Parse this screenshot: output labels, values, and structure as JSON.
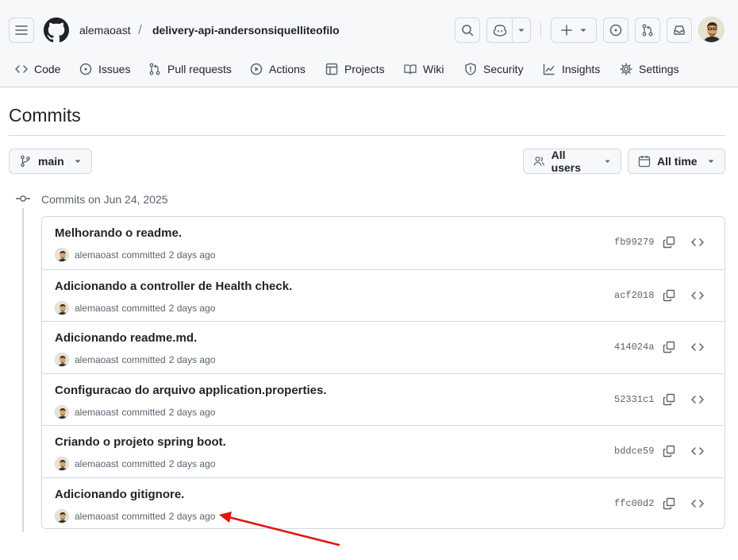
{
  "header": {
    "owner": "alemaoast",
    "separator": "/",
    "repo": "delivery-api-andersonsiquelliteofilo",
    "icons": [
      "hamburger-icon",
      "github-logo",
      "search-icon",
      "copilot-icon",
      "chevron-down-icon",
      "plus-icon",
      "issue-opened-icon",
      "pull-request-icon",
      "inbox-icon"
    ]
  },
  "nav": {
    "items": [
      {
        "label": "Code",
        "icon": "code-icon"
      },
      {
        "label": "Issues",
        "icon": "issue-opened-icon"
      },
      {
        "label": "Pull requests",
        "icon": "pull-request-icon"
      },
      {
        "label": "Actions",
        "icon": "play-icon"
      },
      {
        "label": "Projects",
        "icon": "table-icon"
      },
      {
        "label": "Wiki",
        "icon": "book-icon"
      },
      {
        "label": "Security",
        "icon": "shield-icon"
      },
      {
        "label": "Insights",
        "icon": "graph-icon"
      },
      {
        "label": "Settings",
        "icon": "gear-icon"
      }
    ]
  },
  "page": {
    "title": "Commits"
  },
  "filters": {
    "branch": "main",
    "users": "All users",
    "time": "All time"
  },
  "group": {
    "label": "Commits on Jun 24, 2025"
  },
  "commits": [
    {
      "message": "Melhorando o readme.",
      "author": "alemaoast",
      "action": "committed",
      "when": "2 days ago",
      "sha": "fb99279"
    },
    {
      "message": "Adicionando a controller de Health check.",
      "author": "alemaoast",
      "action": "committed",
      "when": "2 days ago",
      "sha": "acf2018"
    },
    {
      "message": "Adicionando readme.md.",
      "author": "alemaoast",
      "action": "committed",
      "when": "2 days ago",
      "sha": "414024a"
    },
    {
      "message": "Configuracao do arquivo application.properties.",
      "author": "alemaoast",
      "action": "committed",
      "when": "2 days ago",
      "sha": "52331c1"
    },
    {
      "message": "Criando o projeto spring boot.",
      "author": "alemaoast",
      "action": "committed",
      "when": "2 days ago",
      "sha": "bddce59"
    },
    {
      "message": "Adicionando gitignore.",
      "author": "alemaoast",
      "action": "committed",
      "when": "2 days ago",
      "sha": "ffc00d2"
    }
  ],
  "colors": {
    "header_bg": "#f6f8fa",
    "border": "#d1d9e0",
    "text": "#1f2328",
    "muted": "#59636e",
    "annotation_arrow": "#e3130f"
  }
}
